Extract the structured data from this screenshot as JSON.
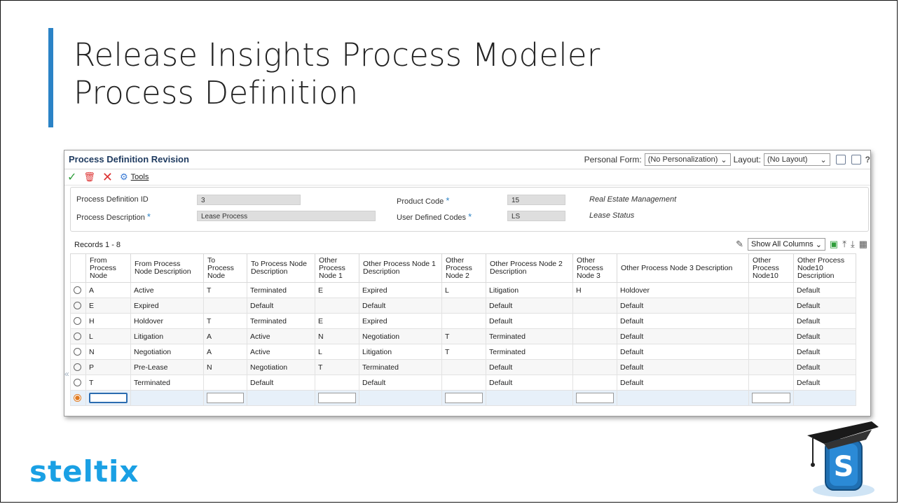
{
  "slide": {
    "title_line1": "Release Insights Process Modeler",
    "title_line2": "Process Definition",
    "logo_text": "steltix",
    "badge_letter": "S",
    "accent_color": "#2b83c6"
  },
  "form": {
    "title": "Process Definition Revision",
    "personal_form_label": "Personal Form:",
    "personal_form_value": "(No Personalization)",
    "layout_label": "Layout:",
    "layout_value": "(No Layout)",
    "help": "?"
  },
  "toolbar": {
    "tools_label": "Tools"
  },
  "header": {
    "process_definition_id_label": "Process Definition ID",
    "process_definition_id_value": "3",
    "process_description_label": "Process Description",
    "process_description_value": "Lease Process",
    "product_code_label": "Product Code",
    "product_code_value": "15",
    "product_code_desc": "Real Estate Management",
    "udc_label": "User Defined Codes",
    "udc_value": "LS",
    "udc_desc": "Lease Status",
    "required_mark": "*"
  },
  "grid": {
    "records_label": "Records 1 - 8",
    "show_all_label": "Show All Columns",
    "collapse_glyph": "«",
    "columns": [
      "From Process Node",
      "From Process Node Description",
      "To Process Node",
      "To Process Node Description",
      "Other Process Node 1",
      "Other Process Node 1 Description",
      "Other Process Node 2",
      "Other Process Node 2 Description",
      "Other Process Node 3",
      "Other Process Node 3 Description",
      "Other Process Node10",
      "Other Process Node10 Description"
    ],
    "rows": [
      [
        "A",
        "Active",
        "T",
        "Terminated",
        "E",
        "Expired",
        "L",
        "Litigation",
        "H",
        "Holdover",
        "",
        "Default"
      ],
      [
        "E",
        "Expired",
        "",
        "Default",
        "",
        "Default",
        "",
        "Default",
        "",
        "Default",
        "",
        "Default"
      ],
      [
        "H",
        "Holdover",
        "T",
        "Terminated",
        "E",
        "Expired",
        "",
        "Default",
        "",
        "Default",
        "",
        "Default"
      ],
      [
        "L",
        "Litigation",
        "A",
        "Active",
        "N",
        "Negotiation",
        "T",
        "Terminated",
        "",
        "Default",
        "",
        "Default"
      ],
      [
        "N",
        "Negotiation",
        "A",
        "Active",
        "L",
        "Litigation",
        "T",
        "Terminated",
        "",
        "Default",
        "",
        "Default"
      ],
      [
        "P",
        "Pre-Lease",
        "N",
        "Negotiation",
        "T",
        "Terminated",
        "",
        "Default",
        "",
        "Default",
        "",
        "Default"
      ],
      [
        "T",
        "Terminated",
        "",
        "Default",
        "",
        "Default",
        "",
        "Default",
        "",
        "Default",
        "",
        "Default"
      ]
    ]
  }
}
